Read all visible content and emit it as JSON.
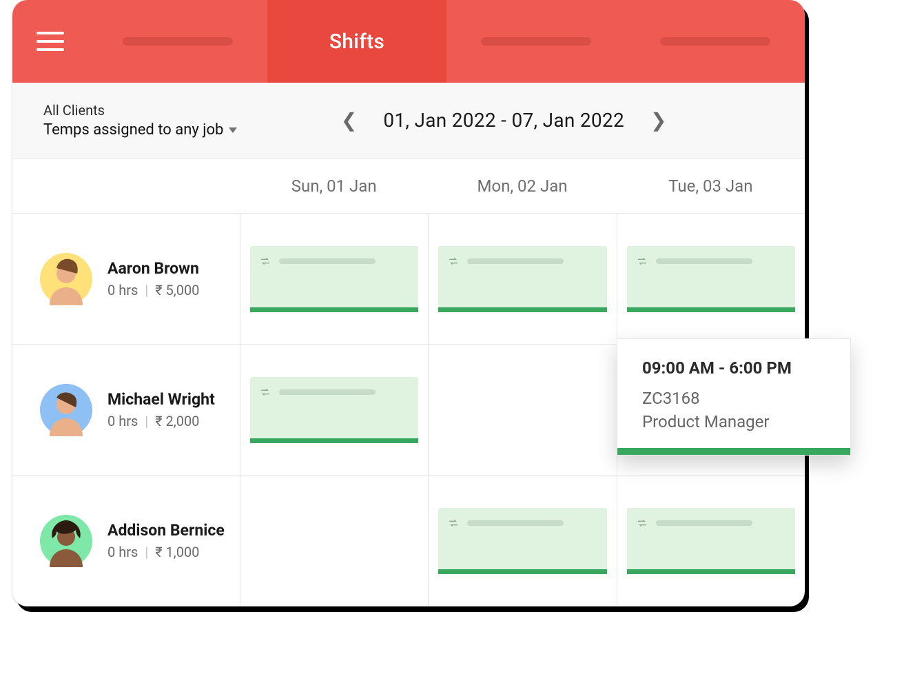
{
  "header": {
    "active_tab_label": "Shifts"
  },
  "filter": {
    "clients_label": "All Clients",
    "temps_label": "Temps assigned to any job",
    "date_range": "01, Jan 2022 - 07, Jan 2022"
  },
  "days": [
    {
      "label": "Sun, 01 Jan"
    },
    {
      "label": "Mon, 02 Jan"
    },
    {
      "label": "Tue, 03 Jan"
    }
  ],
  "people": [
    {
      "name": "Aaron Brown",
      "hours": "0 hrs",
      "amount": "₹ 5,000",
      "avatar_color": "yellow",
      "shifts": [
        true,
        true,
        true
      ]
    },
    {
      "name": "Michael Wright",
      "hours": "0 hrs",
      "amount": "₹ 2,000",
      "avatar_color": "blue",
      "shifts": [
        true,
        false,
        false
      ]
    },
    {
      "name": "Addison Bernice",
      "hours": "0 hrs",
      "amount": "₹ 1,000",
      "avatar_color": "green",
      "shifts": [
        false,
        true,
        true
      ]
    }
  ],
  "popover": {
    "time": "09:00 AM - 6:00 PM",
    "code": "ZC3168",
    "role": "Product Manager"
  },
  "colors": {
    "header_bg": "#ef5b53",
    "accent_green": "#39a85e"
  }
}
